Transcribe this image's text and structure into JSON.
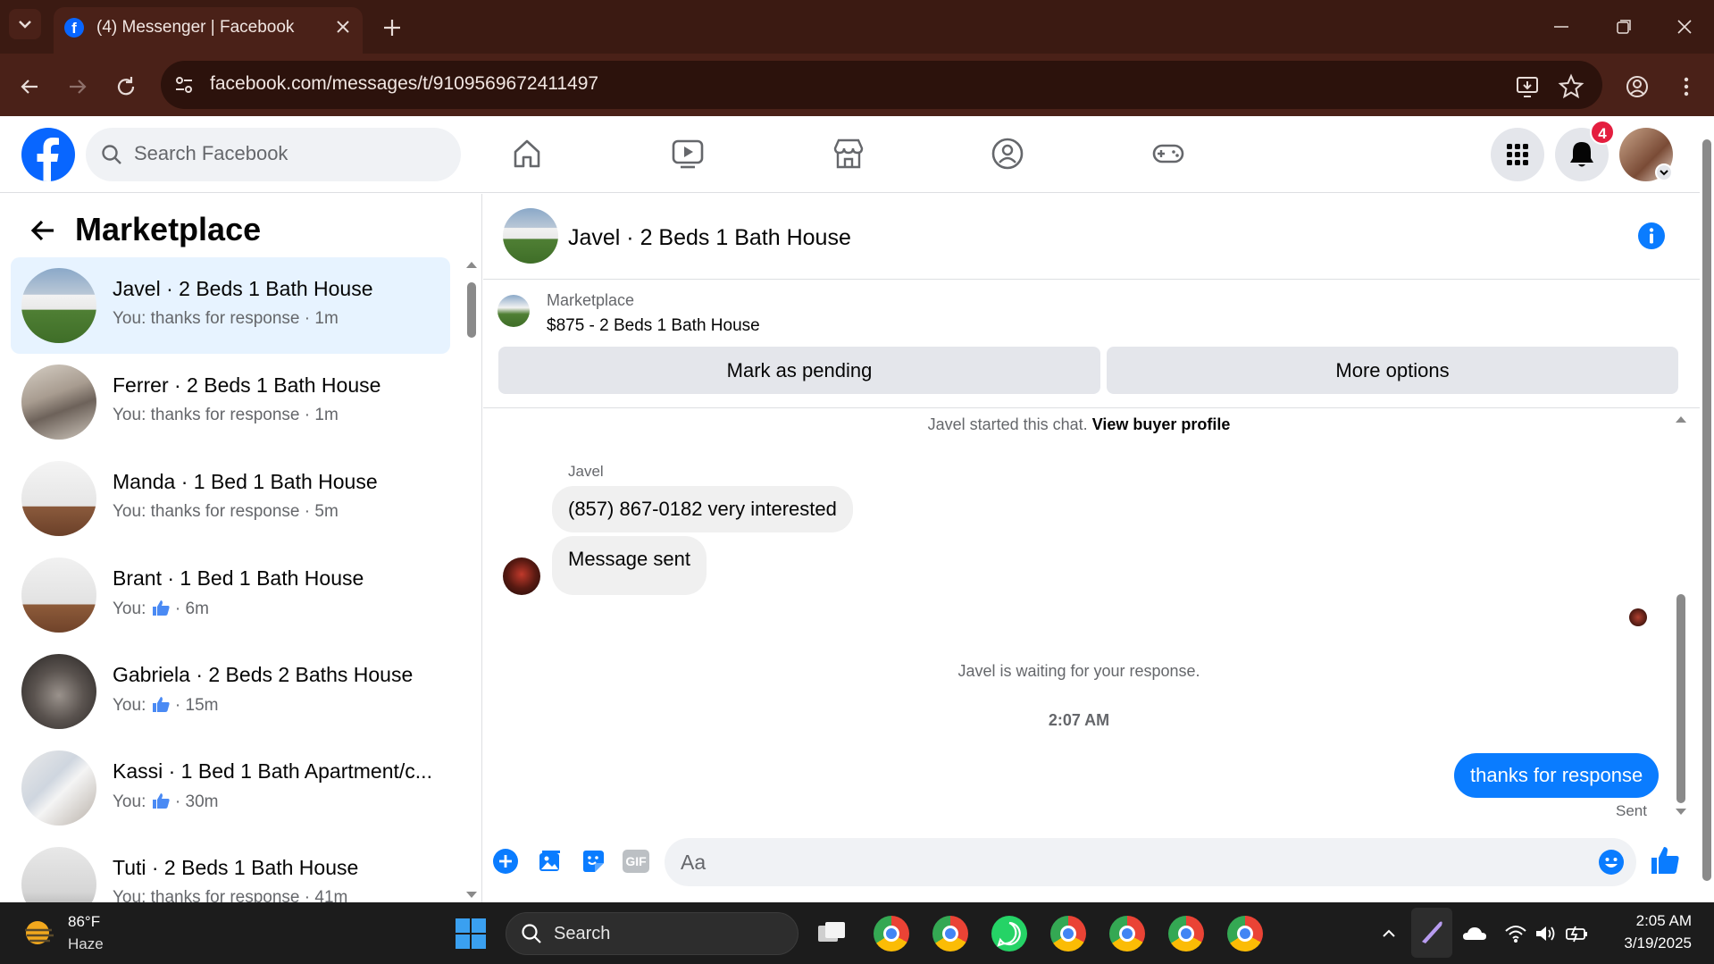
{
  "browser": {
    "tab_title": "(4) Messenger | Facebook",
    "url": "facebook.com/messages/t/9109569672411497"
  },
  "fb": {
    "search_placeholder": "Search Facebook",
    "notification_count": "4"
  },
  "sidebar": {
    "title": "Marketplace",
    "conversations": [
      {
        "name": "Javel · 2 Beds 1 Bath House",
        "preview": "You: thanks for response · 1m",
        "active": true
      },
      {
        "name": "Ferrer · 2 Beds 1 Bath House",
        "preview": "You: thanks for response · 1m"
      },
      {
        "name": "Manda · 1 Bed 1 Bath House",
        "preview": "You: thanks for response · 5m"
      },
      {
        "name": "Brant · 1 Bed 1 Bath House",
        "preview_prefix": "You:",
        "preview_suffix": "· 6m"
      },
      {
        "name": "Gabriela · 2 Beds 2 Baths House",
        "preview_prefix": "You:",
        "preview_suffix": "· 15m"
      },
      {
        "name": "Kassi · 1 Bed 1 Bath Apartment/c...",
        "preview_prefix": "You:",
        "preview_suffix": "· 30m"
      },
      {
        "name": "Tuti · 2 Beds 1 Bath House",
        "preview": "You: thanks for response · 41m"
      }
    ]
  },
  "chat": {
    "title": "Javel · 2 Beds 1 Bath House",
    "marketplace_label": "Marketplace",
    "item_summary": "$875 - 2 Beds 1 Bath House",
    "mark_pending": "Mark as pending",
    "more_options": "More options",
    "started_text": "Javel started this chat.",
    "view_profile": "View buyer profile",
    "sender_name": "Javel",
    "msg1": "(857) 867-0182 very interested",
    "msg2": "Message sent",
    "waiting": "Javel is waiting for your response.",
    "timestamp": "2:07 AM",
    "outgoing": "thanks for response",
    "status": "Sent",
    "composer_placeholder": "Aa"
  },
  "taskbar": {
    "temp": "86°F",
    "weather": "Haze",
    "search": "Search",
    "time": "2:05 AM",
    "date": "3/19/2025"
  },
  "colors": {
    "fb_blue": "#0866ff",
    "messenger_blue": "#0a7cff",
    "badge_red": "#e41e3f",
    "active_row": "#e7f3ff"
  }
}
